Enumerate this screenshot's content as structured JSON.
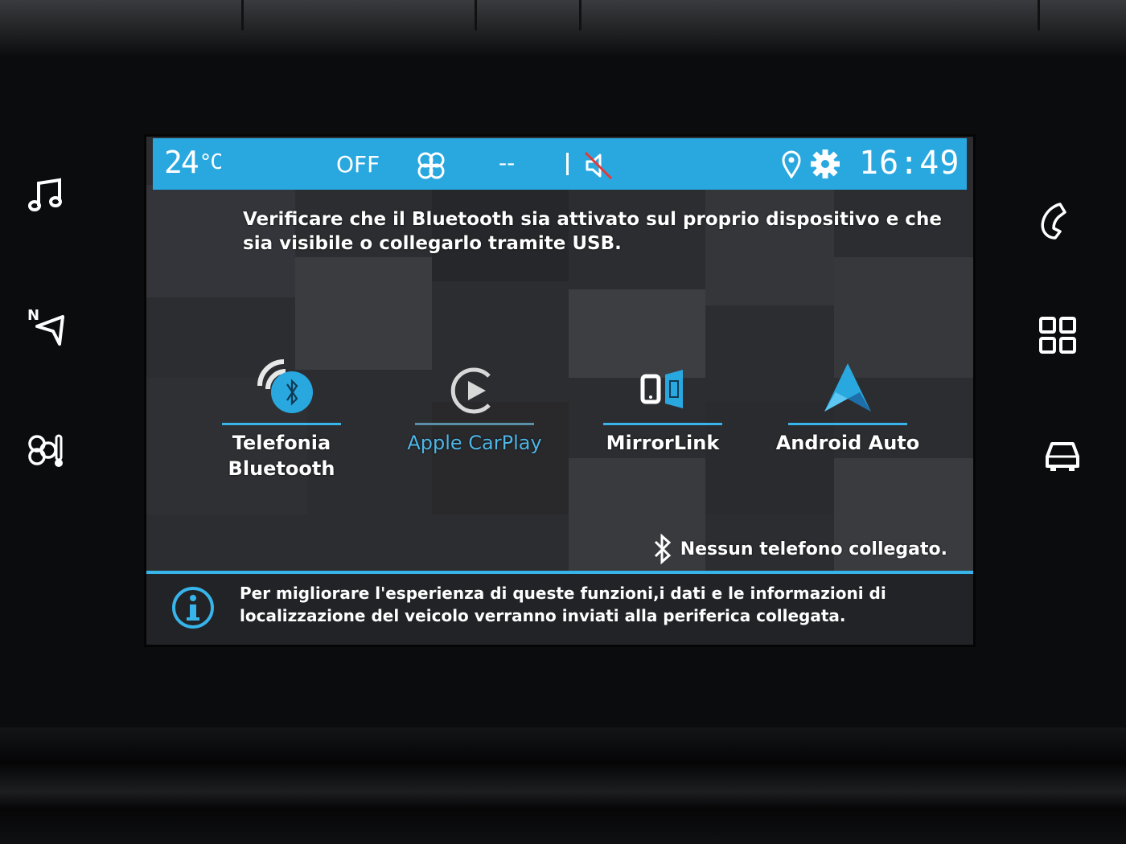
{
  "status_bar": {
    "temperature": "24",
    "temperature_unit": "°C",
    "ac_state": "OFF",
    "fan_speed": "--",
    "time": "16:49",
    "accent_color": "#29a8e0"
  },
  "messages": {
    "top": "Verificare che il Bluetooth sia attivato sul proprio dispositivo e che sia visibile o collegarlo tramite USB.",
    "no_phone": "Nessun telefono collegato.",
    "info": "Per migliorare l'esperienza di queste funzioni,i dati e le informazioni di localizzazione del veicolo verranno inviati alla periferica collegata."
  },
  "apps": [
    {
      "line1": "Telefonia",
      "line2": "Bluetooth",
      "icon": "bluetooth-phone-icon"
    },
    {
      "line1": "Apple CarPlay",
      "line2": "",
      "icon": "carplay-icon"
    },
    {
      "line1": "MirrorLink",
      "line2": "",
      "icon": "mirrorlink-icon"
    },
    {
      "line1": "Android Auto",
      "line2": "",
      "icon": "android-auto-icon"
    }
  ],
  "hardware_buttons": {
    "left": [
      "music-note-icon",
      "navigation-icon",
      "climate-icon"
    ],
    "right": [
      "phone-icon",
      "apps-grid-icon",
      "car-icon"
    ]
  }
}
